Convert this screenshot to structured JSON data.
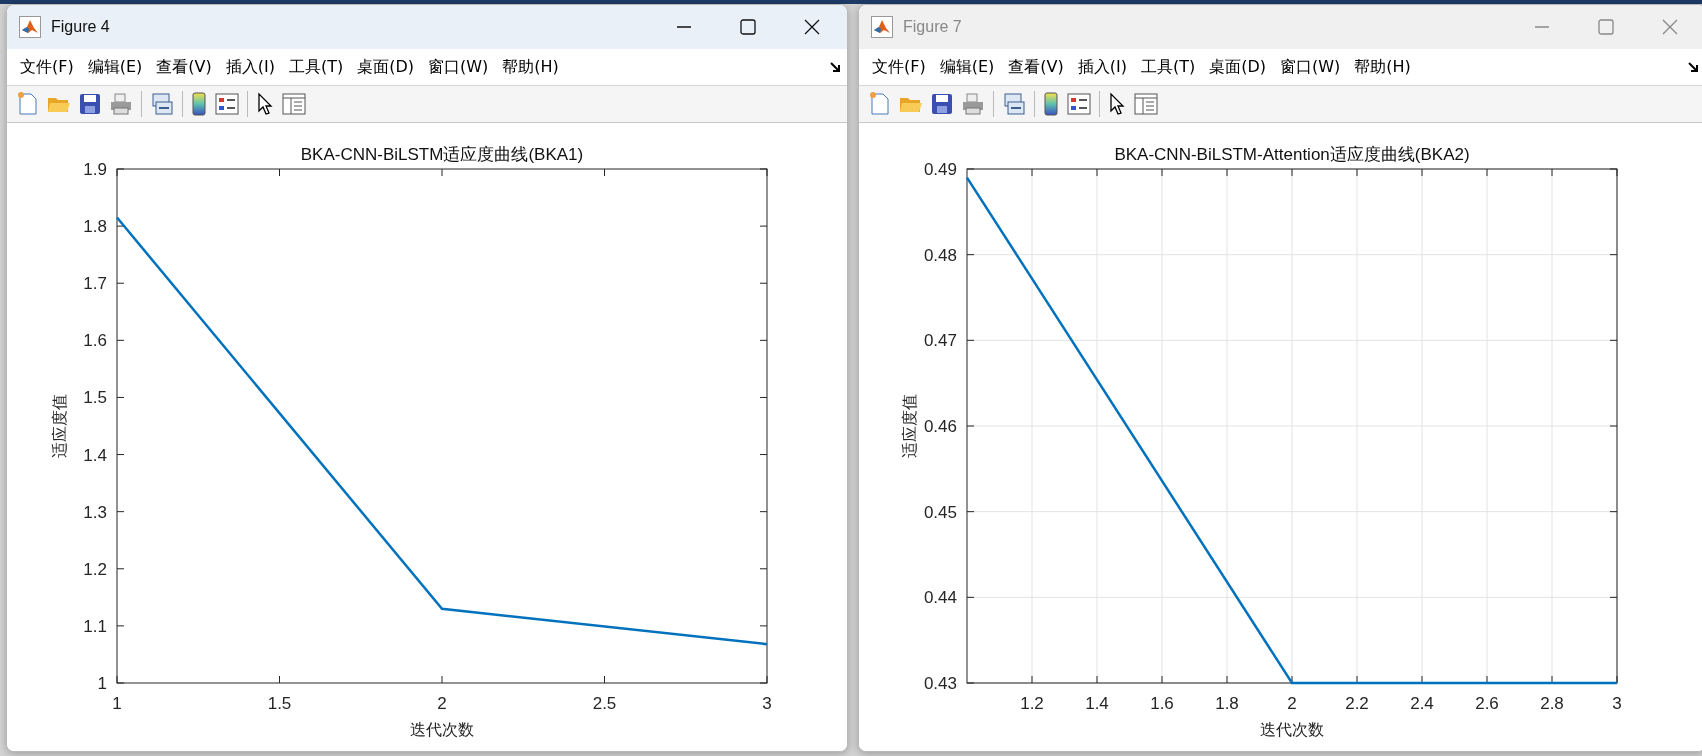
{
  "windows": [
    {
      "title": "Figure 4",
      "active": true,
      "menu": [
        "文件(F)",
        "编辑(E)",
        "查看(V)",
        "插入(I)",
        "工具(T)",
        "桌面(D)",
        "窗口(W)",
        "帮助(H)"
      ],
      "chart_data": {
        "type": "line",
        "title": "BKA-CNN-BiLSTM适应度曲线(BKA1)",
        "xlabel": "迭代次数",
        "ylabel": "适应度值",
        "x": [
          1,
          2,
          3
        ],
        "series": [
          {
            "color": "#0072bd",
            "values": [
              1.815,
              1.13,
              1.068
            ]
          }
        ],
        "xlim": [
          1,
          3
        ],
        "ylim": [
          1,
          1.9
        ],
        "xticks": [
          1,
          1.5,
          2,
          2.5,
          3
        ],
        "yticks": [
          1,
          1.1,
          1.2,
          1.3,
          1.4,
          1.5,
          1.6,
          1.7,
          1.8,
          1.9
        ],
        "grid": false
      }
    },
    {
      "title": "Figure 7",
      "active": false,
      "menu": [
        "文件(F)",
        "编辑(E)",
        "查看(V)",
        "插入(I)",
        "工具(T)",
        "桌面(D)",
        "窗口(W)",
        "帮助(H)"
      ],
      "chart_data": {
        "type": "line",
        "title": "BKA-CNN-BiLSTM-Attention适应度曲线(BKA2)",
        "xlabel": "迭代次数",
        "ylabel": "适应度值",
        "x": [
          1,
          2,
          3
        ],
        "series": [
          {
            "color": "#0072bd",
            "values": [
              0.489,
              0.43,
              0.43
            ]
          }
        ],
        "xlim": [
          1,
          3
        ],
        "ylim": [
          0.43,
          0.49
        ],
        "xticks": [
          1.2,
          1.4,
          1.6,
          1.8,
          2,
          2.2,
          2.4,
          2.6,
          2.8,
          3
        ],
        "yticks": [
          0.43,
          0.44,
          0.45,
          0.46,
          0.47,
          0.48,
          0.49
        ],
        "grid": true
      }
    }
  ]
}
